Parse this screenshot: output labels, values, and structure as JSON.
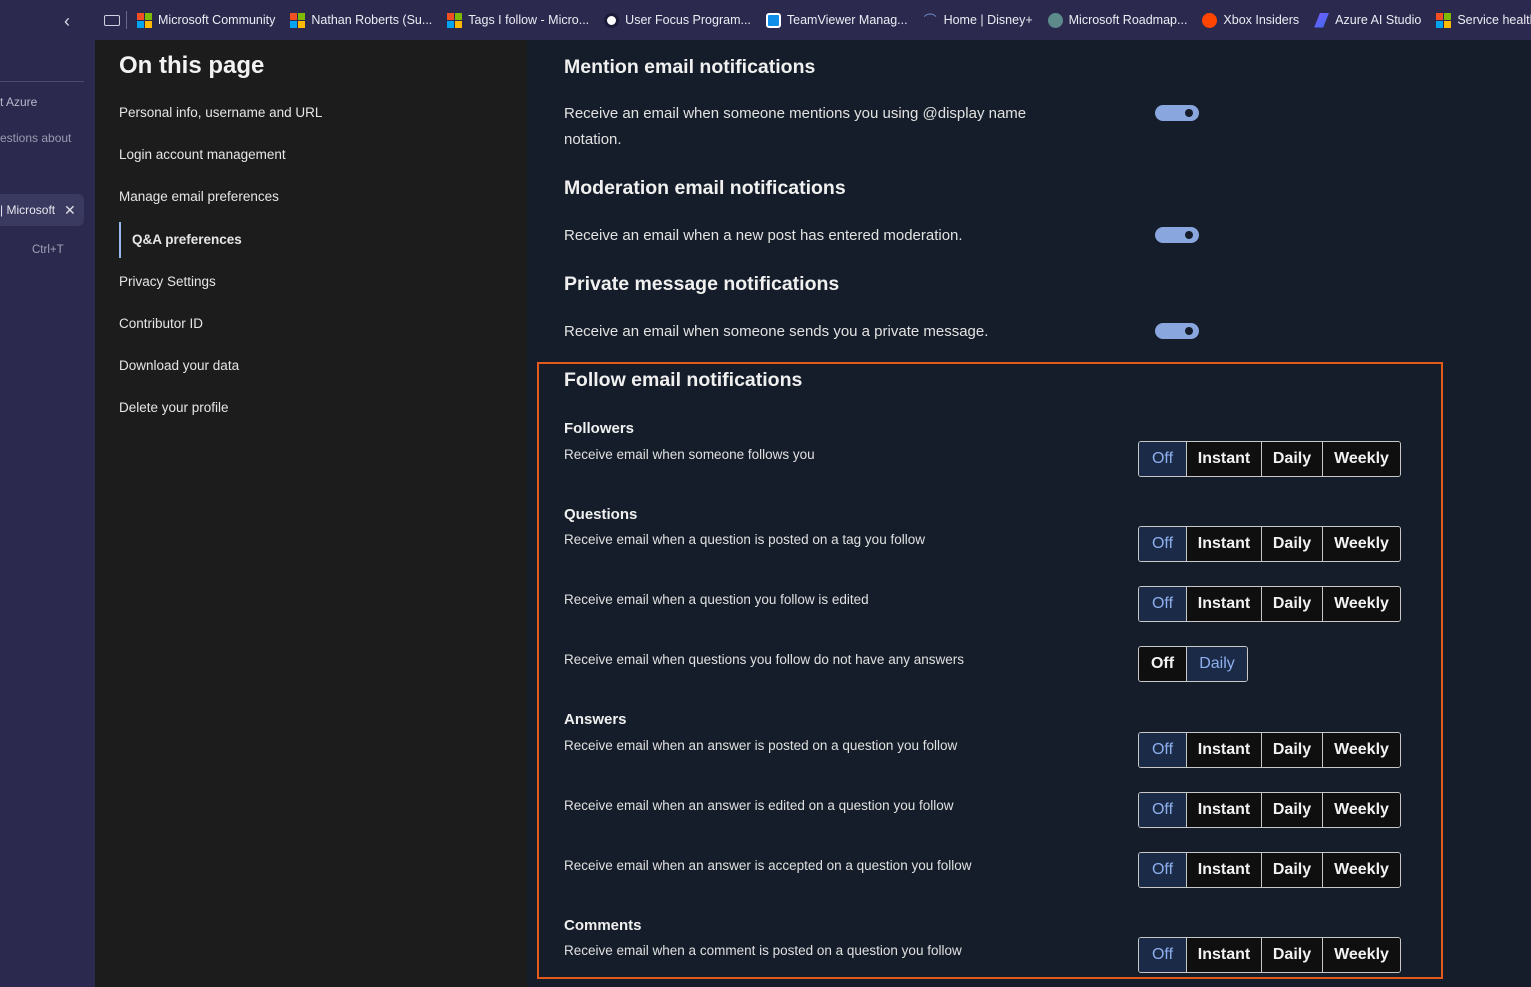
{
  "favorites": [
    {
      "label": "Microsoft Community",
      "icon": "microsoft-logo-icon"
    },
    {
      "label": "Nathan Roberts (Su...",
      "icon": "microsoft-logo-icon"
    },
    {
      "label": "Tags I follow - Micro...",
      "icon": "microsoft-logo-icon"
    },
    {
      "label": "User Focus Program...",
      "icon": "circle-logo-icon"
    },
    {
      "label": "TeamViewer Manag...",
      "icon": "teamviewer-icon"
    },
    {
      "label": "Home | Disney+",
      "icon": "disney-icon"
    },
    {
      "label": "Microsoft Roadmap...",
      "icon": "roadmap-icon"
    },
    {
      "label": "Xbox Insiders",
      "icon": "reddit-icon"
    },
    {
      "label": "Azure AI Studio",
      "icon": "azure-ai-icon"
    },
    {
      "label": "Service health - M",
      "icon": "microsoft-logo-icon"
    }
  ],
  "browser_sidebar": {
    "text1": "t Azure",
    "text2": "estions about",
    "tab_label": "| Microsoft",
    "tab_close": "✕",
    "shortcut": "Ctrl+T"
  },
  "on_this_page": {
    "title": "On this page",
    "items": [
      "Personal info, username and URL",
      "Login account management",
      "Manage email preferences",
      "Q&A preferences",
      "Privacy Settings",
      "Contributor ID",
      "Download your data",
      "Delete your profile"
    ]
  },
  "mention": {
    "title": "Mention email notifications",
    "desc_line1": "Receive an email when someone mentions you using @display name",
    "desc_line2": "notation.",
    "enabled": true
  },
  "moderation": {
    "title": "Moderation email notifications",
    "desc": "Receive an email when a new post has entered moderation.",
    "enabled": true
  },
  "private_message": {
    "title": "Private message notifications",
    "desc": "Receive an email when someone sends you a private message.",
    "enabled": true
  },
  "follow": {
    "title": "Follow email notifications",
    "options4": [
      "Off",
      "Instant",
      "Daily",
      "Weekly"
    ],
    "options2": [
      "Off",
      "Daily"
    ],
    "followers_title": "Followers",
    "followers_desc": "Receive email when someone follows you",
    "questions_title": "Questions",
    "q1_desc": "Receive email when a question is posted on a tag you follow",
    "q2_desc": "Receive email when a question you follow is edited",
    "q3_desc": "Receive email when questions you follow do not have any answers",
    "answers_title": "Answers",
    "a1_desc": "Receive email when an answer is posted on a question you follow",
    "a2_desc": "Receive email when an answer is edited on a question you follow",
    "a3_desc": "Receive email when an answer is accepted on a question you follow",
    "comments_title": "Comments",
    "c1_desc": "Receive email when a comment is posted on a question you follow",
    "selected": {
      "followers": "Off",
      "q1": "Off",
      "q2": "Off",
      "q3": "Daily",
      "a1": "Off",
      "a2": "Off",
      "a3": "Off",
      "c1": "Off"
    }
  },
  "colors": {
    "accent": "#8fb0ee",
    "highlight_border": "#e4591c",
    "toggle_on": "#8aa6df"
  }
}
